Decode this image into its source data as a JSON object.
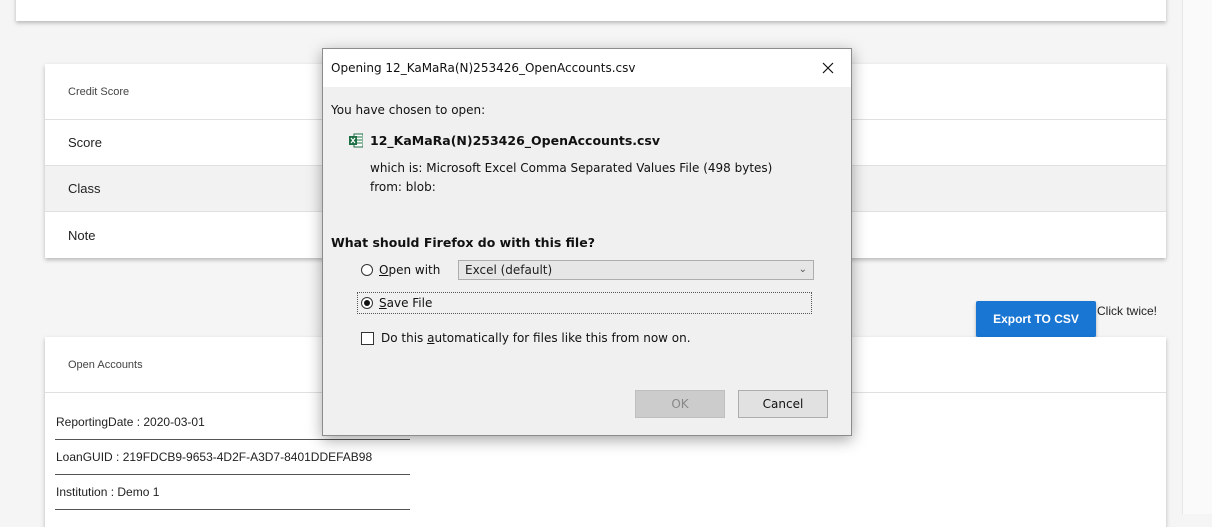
{
  "credit_score": {
    "header": "Credit Score",
    "rows": [
      "Score",
      "Class",
      "Note"
    ]
  },
  "export": {
    "button_label": "Export TO CSV",
    "hint": "Click twice!"
  },
  "open_accounts": {
    "header": "Open Accounts",
    "items": [
      "ReportingDate : 2020-03-01",
      "LoanGUID : 219FDCB9-9653-4D2F-A3D7-8401DDEFAB98",
      "Institution : Demo 1"
    ]
  },
  "dialog": {
    "title": "Opening 12_KaMaRa(N)253426_OpenAccounts.csv",
    "chosen_label": "You have chosen to open:",
    "file_name": "12_KaMaRa(N)253426_OpenAccounts.csv",
    "which_is": "which is: Microsoft Excel Comma Separated Values File (498 bytes)",
    "from": "from: blob:",
    "question": "What should Firefox do with this file?",
    "open_with_prefix": "",
    "open_with_accel": "O",
    "open_with_rest": "pen with",
    "app_selected": "Excel (default)",
    "save_accel": "S",
    "save_rest": "ave File",
    "auto_prefix": "Do this ",
    "auto_accel": "a",
    "auto_rest": "utomatically for files like this from now on.",
    "ok_label": "OK",
    "cancel_label": "Cancel",
    "selected_option": "save-file",
    "auto_checked": false,
    "icon_color": "#1d7044"
  }
}
